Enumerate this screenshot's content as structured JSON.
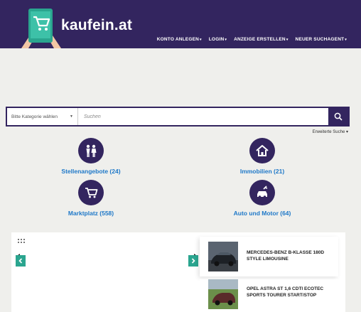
{
  "header": {
    "brand": "kaufein.at",
    "nav": [
      {
        "label": "KONTO ANLEGEN"
      },
      {
        "label": "LOGIN"
      },
      {
        "label": "ANZEIGE ERSTELLEN"
      },
      {
        "label": "NEUER SUCHAGENT"
      }
    ]
  },
  "search": {
    "category_label": "Bitte Kategorie wählen",
    "placeholder": "Suchen",
    "advanced_label": "Erweiterte Suche"
  },
  "categories": [
    {
      "label": "Stellenangebote (24)",
      "icon": "people-icon"
    },
    {
      "label": "Immobilien (21)",
      "icon": "house-icon"
    },
    {
      "label": "Marktplatz (558)",
      "icon": "cart-icon"
    },
    {
      "label": "Auto und Motor (64)",
      "icon": "car-icon"
    }
  ],
  "listings": [
    {
      "title": "MERCEDES-BENZ B-KLASSE 180D STYLE LIMOUSINE"
    },
    {
      "title": "OPEL ASTRA ST 1,6 CDTI ECOTEC SPORTS TOURER START/STOP"
    }
  ],
  "colors": {
    "brand": "#33255f",
    "link": "#1e78c8",
    "accent": "#2aa58f"
  }
}
